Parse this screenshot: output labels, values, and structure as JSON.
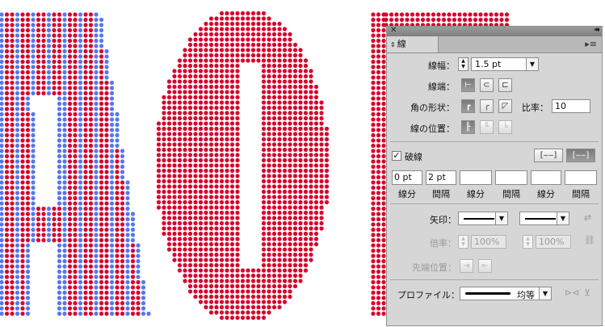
{
  "panel": {
    "tab_label": "線",
    "close_glyph": "✕",
    "collapse_glyph": "◂◂",
    "stroke_weight_label": "線幅：",
    "stroke_weight_value": "1.5 pt",
    "cap_label": "線端：",
    "corner_label": "角の形状：",
    "miter_label": "比率：",
    "miter_value": "10",
    "align_label": "線の位置：",
    "dashed_label": "破線",
    "dashed_checked": "✓",
    "dash_values": [
      "0 pt",
      "2 pt",
      "",
      "",
      "",
      ""
    ],
    "dash_labels": [
      "線分",
      "間隔",
      "線分",
      "間隔",
      "線分",
      "間隔"
    ],
    "arrow_label": "矢印：",
    "scale_label": "倍率：",
    "scale_value_1": "100%",
    "scale_value_2": "100%",
    "align_arrow_label": "先端位置：",
    "profile_label": "プロファイル：",
    "profile_value": "均等"
  },
  "colors": {
    "dot_red": "#d8002c",
    "dot_blue": "#5577ee",
    "panel_bg": "#d6d6d6"
  },
  "icons": [
    "close-icon",
    "collapse-icon",
    "panel-menu-icon",
    "swap-arrows-icon",
    "link-scale-icon",
    "flip-profile-icon"
  ]
}
